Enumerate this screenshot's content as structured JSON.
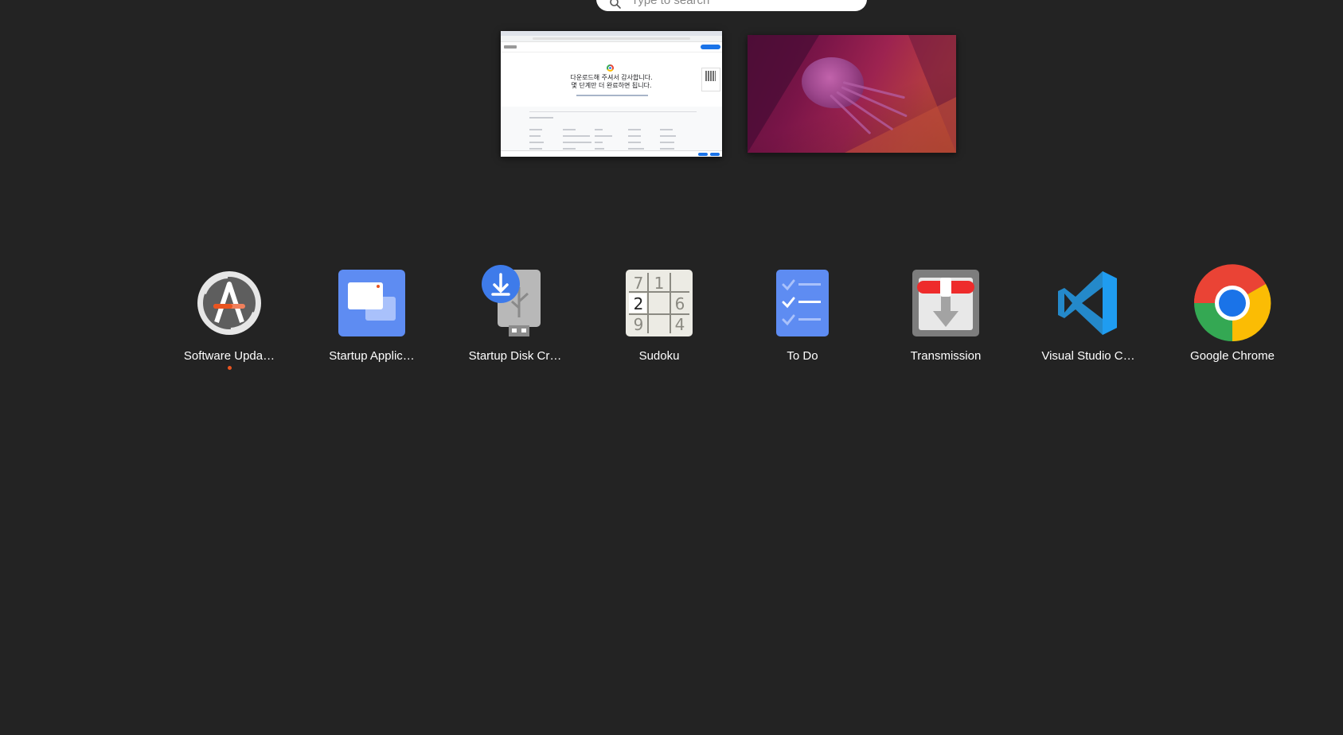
{
  "search": {
    "placeholder": "Type to search",
    "icon": "search-icon"
  },
  "workspaces": [
    {
      "name": "workspace-1",
      "window": "Google Chrome",
      "preview_text": {
        "line1": "다운로드해 주셔서 감사합니다.",
        "line2": "몇 단계만 더 완료하면 됩니다."
      }
    },
    {
      "name": "workspace-2",
      "window": ""
    }
  ],
  "apps": [
    {
      "label": "Software Upda…",
      "icon": "software-updater-icon",
      "running": true
    },
    {
      "label": "Startup Applic…",
      "icon": "startup-applications-icon",
      "running": false
    },
    {
      "label": "Startup Disk Cr…",
      "icon": "startup-disk-creator-icon",
      "running": false
    },
    {
      "label": "Sudoku",
      "icon": "sudoku-icon",
      "running": false,
      "digits": [
        "7",
        "1",
        "2",
        "6",
        "9",
        "4"
      ]
    },
    {
      "label": "To Do",
      "icon": "todo-icon",
      "running": false
    },
    {
      "label": "Transmission",
      "icon": "transmission-icon",
      "running": false
    },
    {
      "label": "Visual Studio C…",
      "icon": "vscode-icon",
      "running": false
    },
    {
      "label": "Google Chrome",
      "icon": "chrome-icon",
      "running": false
    }
  ],
  "colors": {
    "background": "#232323",
    "running_indicator": "#e95420",
    "accent_blue": "#5e8cf2"
  }
}
